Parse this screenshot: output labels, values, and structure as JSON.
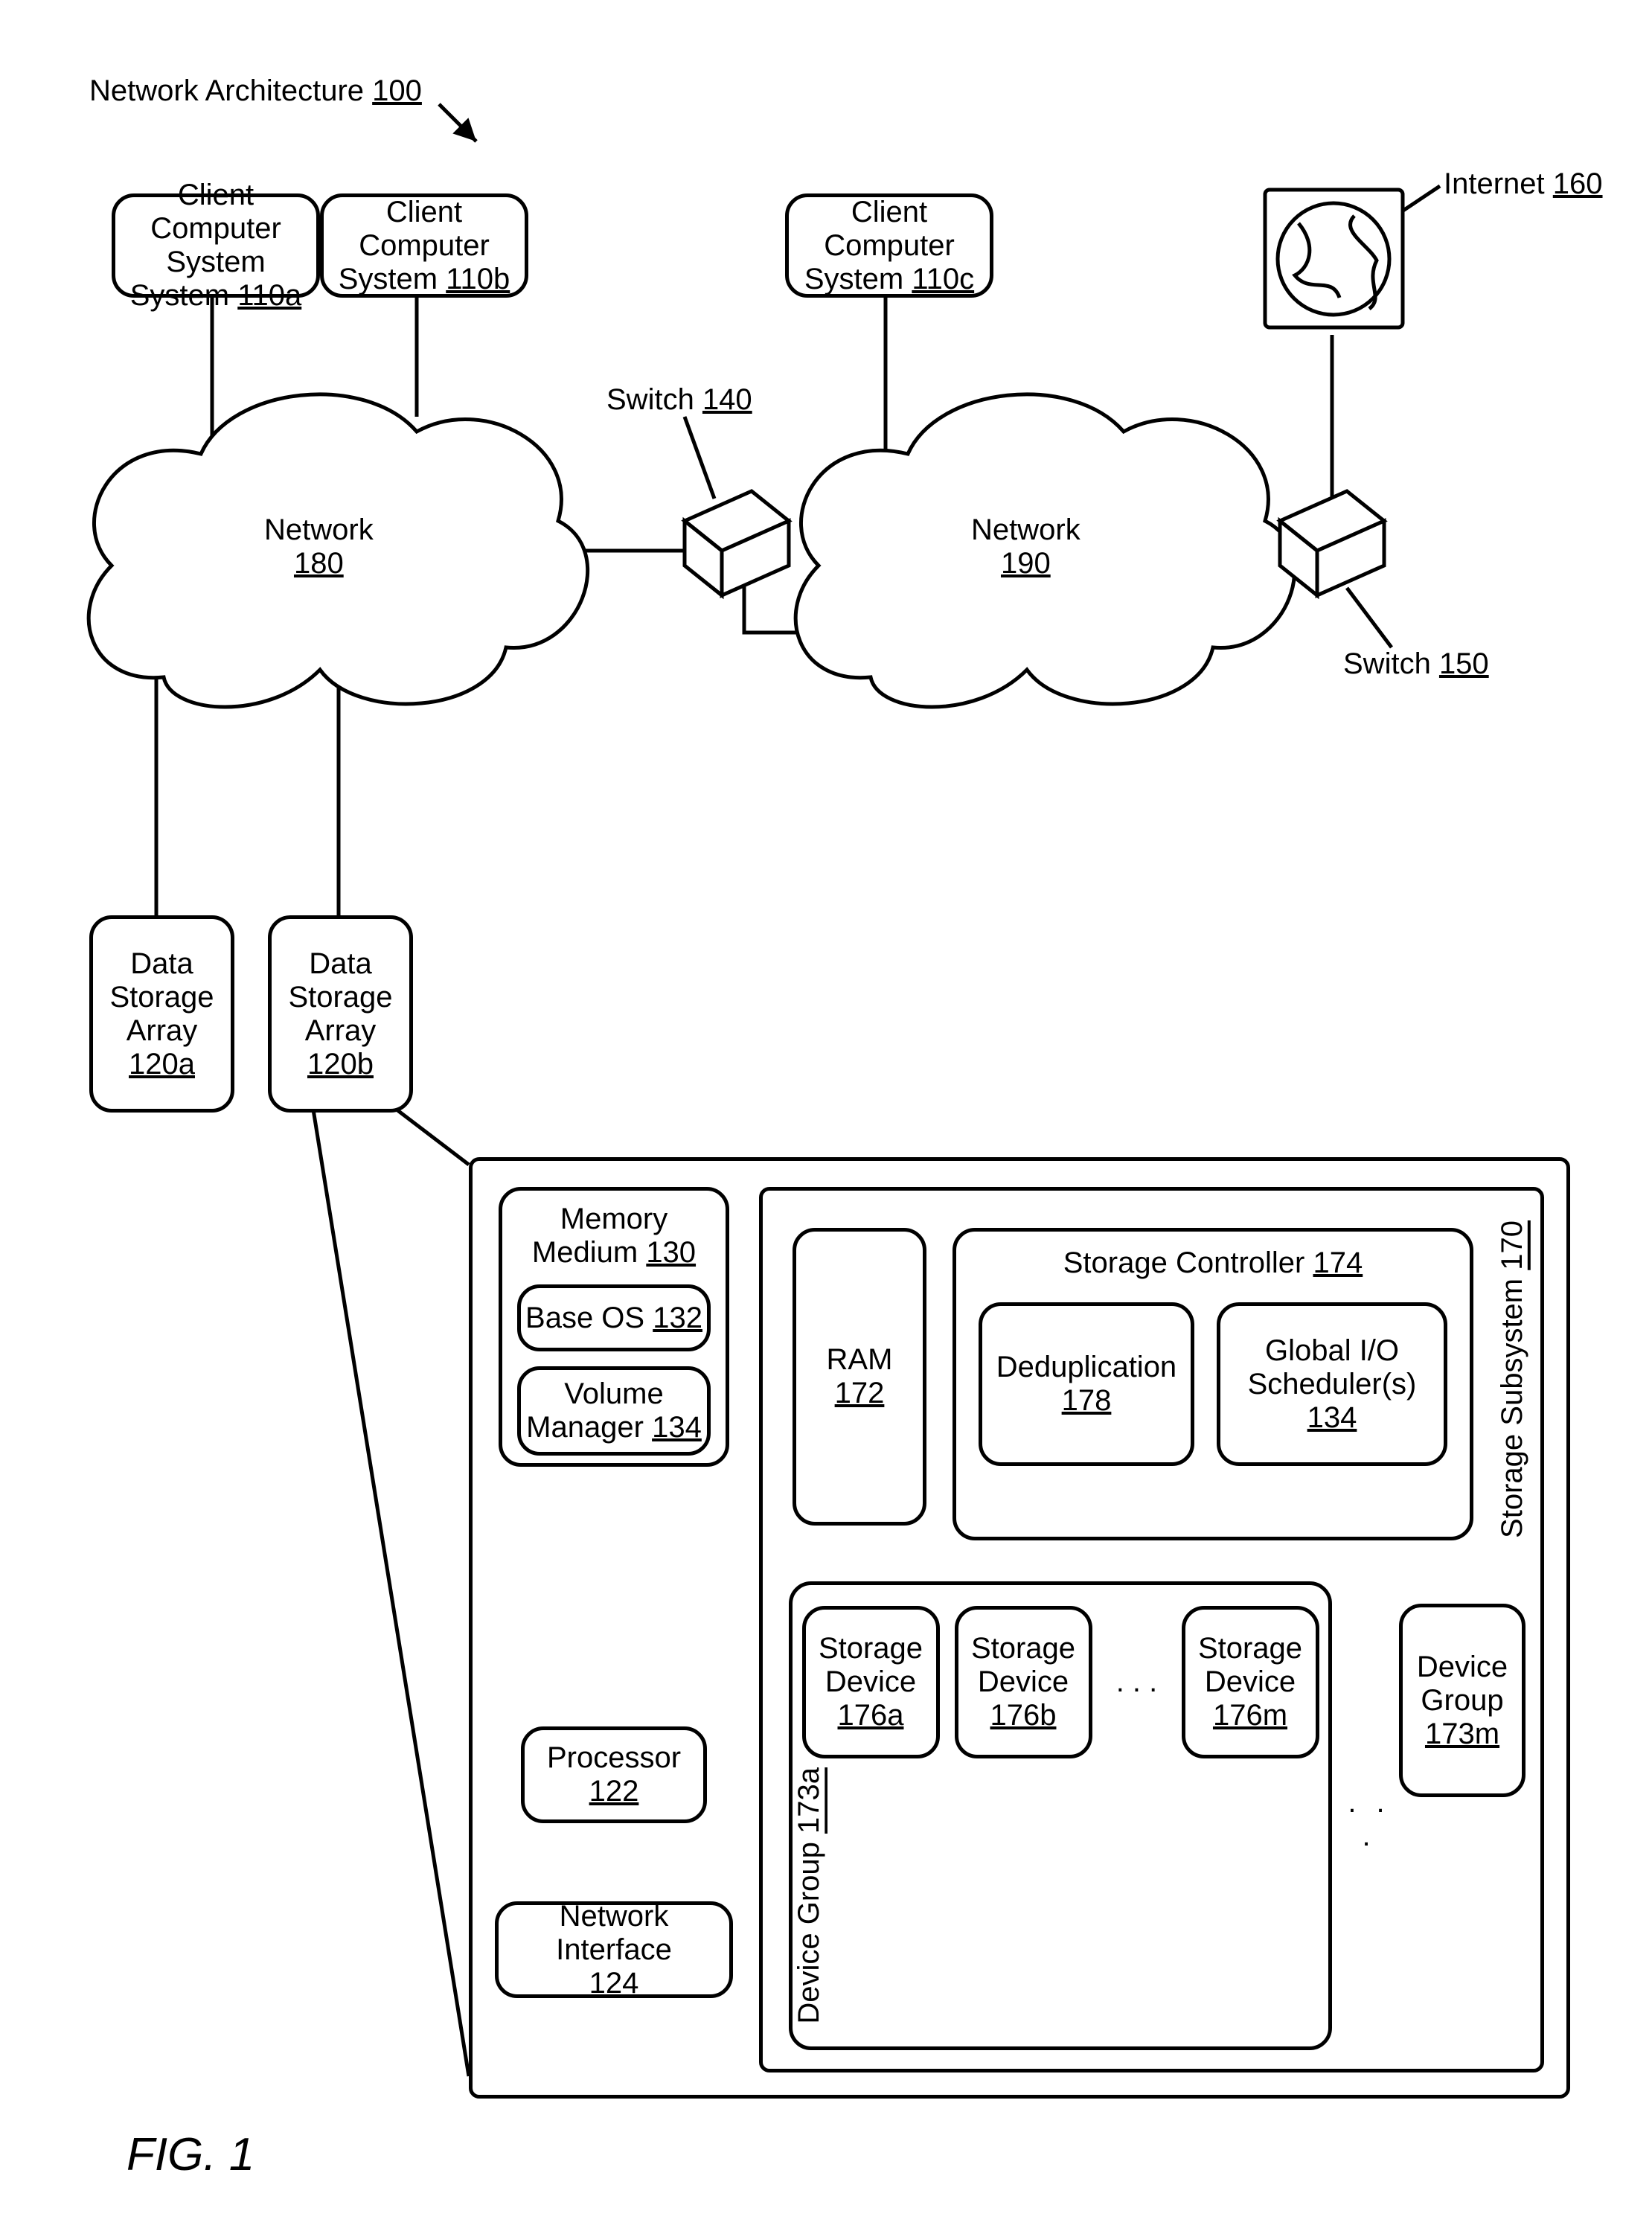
{
  "figure": "FIG. 1",
  "title": {
    "label": "Network Architecture",
    "ref": "100"
  },
  "clients": {
    "a": {
      "label": "Client Computer System",
      "ref": "110a"
    },
    "b": {
      "label": "Client Computer System",
      "ref": "110b"
    },
    "c": {
      "label": "Client Computer System",
      "ref": "110c"
    }
  },
  "internet": {
    "label": "Internet",
    "ref": "160"
  },
  "networks": {
    "a": {
      "label": "Network",
      "ref": "180"
    },
    "b": {
      "label": "Network",
      "ref": "190"
    }
  },
  "switches": {
    "a": {
      "label": "Switch",
      "ref": "140"
    },
    "b": {
      "label": "Switch",
      "ref": "150"
    }
  },
  "arrays": {
    "a": {
      "label": "Data Storage Array",
      "ref": "120a"
    },
    "b": {
      "label": "Data Storage Array",
      "ref": "120b"
    }
  },
  "internal": {
    "memory": {
      "label": "Memory Medium",
      "ref": "130"
    },
    "baseos": {
      "label": "Base OS",
      "ref": "132"
    },
    "volmgr": {
      "label": "Volume Manager",
      "ref": "134"
    },
    "processor": {
      "label": "Processor",
      "ref": "122"
    },
    "netif": {
      "label": "Network Interface",
      "ref": "124"
    },
    "subsystem": {
      "label": "Storage Subsystem",
      "ref": "170"
    },
    "ram": {
      "label": "RAM",
      "ref": "172"
    },
    "controller": {
      "label": "Storage Controller",
      "ref": "174"
    },
    "dedup": {
      "label": "Deduplication",
      "ref": "178"
    },
    "sched": {
      "label": "Global I/O Scheduler(s)",
      "ref": "134"
    },
    "devgroup_a": {
      "label": "Device Group",
      "ref": "173a"
    },
    "devgroup_m": {
      "label": "Device Group",
      "ref": "173m"
    },
    "sd_a": {
      "label": "Storage Device",
      "ref": "176a"
    },
    "sd_b": {
      "label": "Storage Device",
      "ref": "176b"
    },
    "sd_m": {
      "label": "Storage Device",
      "ref": "176m"
    }
  },
  "ellipsis_h": ".   .   .",
  "ellipsis_h2": ".  .  ."
}
